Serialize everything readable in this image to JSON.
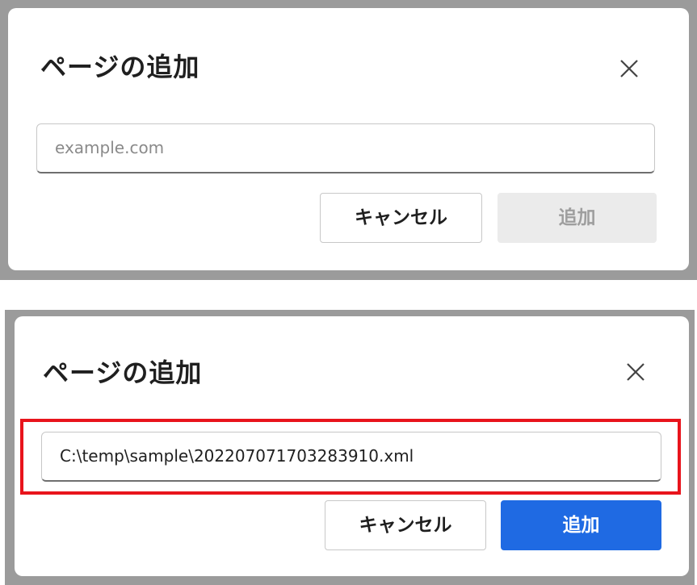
{
  "dialog_before": {
    "title": "ページの追加",
    "close_icon": "close-icon",
    "input": {
      "value": "",
      "placeholder": "example.com"
    },
    "buttons": {
      "cancel_label": "キャンセル",
      "add_label": "追加",
      "add_state": "disabled"
    }
  },
  "dialog_after": {
    "title": "ページの追加",
    "close_icon": "close-icon",
    "input": {
      "value": "C:\\temp\\sample\\20220707170328391​0.xml",
      "placeholder": "example.com"
    },
    "buttons": {
      "cancel_label": "キャンセル",
      "add_label": "追加",
      "add_state": "enabled"
    },
    "highlight_color": "#e8141c"
  },
  "colors": {
    "backdrop": "#9b9b9b",
    "primary_button": "#1f6ae3",
    "disabled_button": "#ebebeb",
    "highlight": "#e8141c"
  }
}
